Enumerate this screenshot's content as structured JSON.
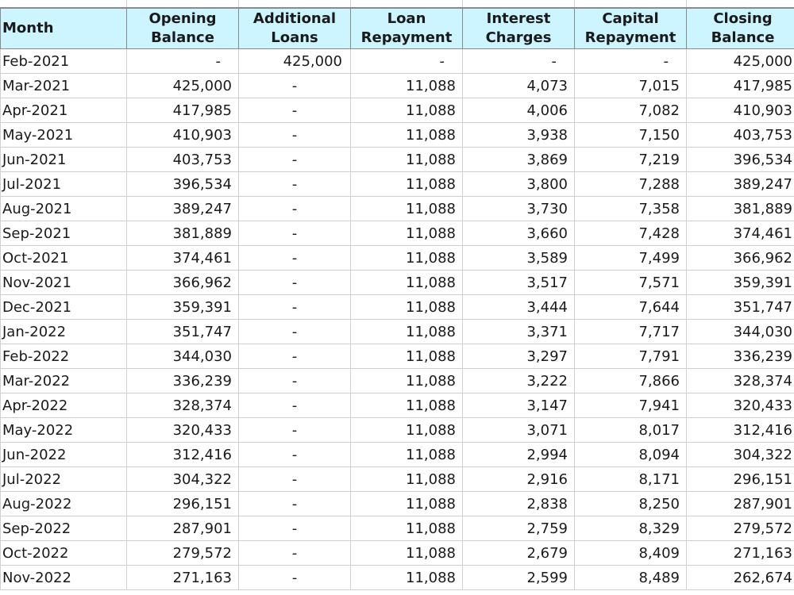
{
  "headers": [
    {
      "line1": "Month",
      "line2": ""
    },
    {
      "line1": "Opening",
      "line2": "Balance"
    },
    {
      "line1": "Additional",
      "line2": "Loans"
    },
    {
      "line1": "Loan",
      "line2": "Repayment"
    },
    {
      "line1": "Interest",
      "line2": "Charges"
    },
    {
      "line1": "Capital",
      "line2": "Repayment"
    },
    {
      "line1": "Closing",
      "line2": "Balance"
    }
  ],
  "rows": [
    [
      "Feb-2021",
      "-",
      "425,000",
      "-",
      "-",
      "-",
      "425,000"
    ],
    [
      "Mar-2021",
      "425,000",
      "-",
      "11,088",
      "4,073",
      "7,015",
      "417,985"
    ],
    [
      "Apr-2021",
      "417,985",
      "-",
      "11,088",
      "4,006",
      "7,082",
      "410,903"
    ],
    [
      "May-2021",
      "410,903",
      "-",
      "11,088",
      "3,938",
      "7,150",
      "403,753"
    ],
    [
      "Jun-2021",
      "403,753",
      "-",
      "11,088",
      "3,869",
      "7,219",
      "396,534"
    ],
    [
      "Jul-2021",
      "396,534",
      "-",
      "11,088",
      "3,800",
      "7,288",
      "389,247"
    ],
    [
      "Aug-2021",
      "389,247",
      "-",
      "11,088",
      "3,730",
      "7,358",
      "381,889"
    ],
    [
      "Sep-2021",
      "381,889",
      "-",
      "11,088",
      "3,660",
      "7,428",
      "374,461"
    ],
    [
      "Oct-2021",
      "374,461",
      "-",
      "11,088",
      "3,589",
      "7,499",
      "366,962"
    ],
    [
      "Nov-2021",
      "366,962",
      "-",
      "11,088",
      "3,517",
      "7,571",
      "359,391"
    ],
    [
      "Dec-2021",
      "359,391",
      "-",
      "11,088",
      "3,444",
      "7,644",
      "351,747"
    ],
    [
      "Jan-2022",
      "351,747",
      "-",
      "11,088",
      "3,371",
      "7,717",
      "344,030"
    ],
    [
      "Feb-2022",
      "344,030",
      "-",
      "11,088",
      "3,297",
      "7,791",
      "336,239"
    ],
    [
      "Mar-2022",
      "336,239",
      "-",
      "11,088",
      "3,222",
      "7,866",
      "328,374"
    ],
    [
      "Apr-2022",
      "328,374",
      "-",
      "11,088",
      "3,147",
      "7,941",
      "320,433"
    ],
    [
      "May-2022",
      "320,433",
      "-",
      "11,088",
      "3,071",
      "8,017",
      "312,416"
    ],
    [
      "Jun-2022",
      "312,416",
      "-",
      "11,088",
      "2,994",
      "8,094",
      "304,322"
    ],
    [
      "Jul-2022",
      "304,322",
      "-",
      "11,088",
      "2,916",
      "8,171",
      "296,151"
    ],
    [
      "Aug-2022",
      "296,151",
      "-",
      "11,088",
      "2,838",
      "8,250",
      "287,901"
    ],
    [
      "Sep-2022",
      "287,901",
      "-",
      "11,088",
      "2,759",
      "8,329",
      "279,572"
    ],
    [
      "Oct-2022",
      "279,572",
      "-",
      "11,088",
      "2,679",
      "8,409",
      "271,163"
    ],
    [
      "Nov-2022",
      "271,163",
      "-",
      "11,088",
      "2,599",
      "8,489",
      "262,674"
    ]
  ],
  "colors": {
    "header_bg": "#ccf5ff",
    "header_border": "#8a8a8a",
    "grid": "#d0d0d0",
    "text": "#1a1a1a"
  }
}
